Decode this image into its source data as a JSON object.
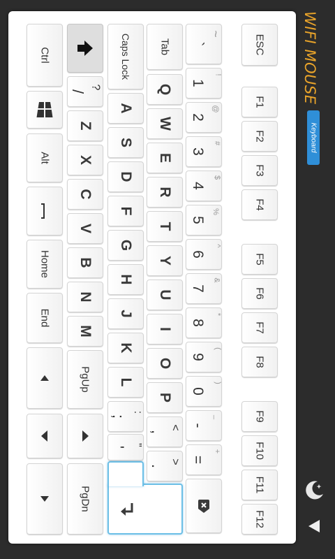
{
  "brand": {
    "title": "WIFI MOUSE",
    "subtitle": "Keyboard"
  },
  "keys": {
    "esc": "ESC",
    "f1": "F1",
    "f2": "F2",
    "f3": "F3",
    "f4": "F4",
    "f5": "F5",
    "f6": "F6",
    "f7": "F7",
    "f8": "F8",
    "f9": "F9",
    "f10": "F10",
    "f11": "F11",
    "f12": "F12",
    "grave": "`",
    "grave_shift": "~",
    "d1": "1",
    "d1s": "!",
    "d2": "2",
    "d2s": "@",
    "d3": "3",
    "d3s": "#",
    "d4": "4",
    "d4s": "$",
    "d5": "5",
    "d5s": "%",
    "d6": "6",
    "d6s": "^",
    "d7": "7",
    "d7s": "&",
    "d8": "8",
    "d8s": "*",
    "d9": "9",
    "d9s": "(",
    "d0": "0",
    "d0s": ")",
    "minus": "-",
    "minus_s": "_",
    "equal": "=",
    "equal_s": "+",
    "tab": "Tab",
    "q": "Q",
    "w": "W",
    "e": "E",
    "r": "R",
    "t": "T",
    "y": "Y",
    "u": "U",
    "i": "I",
    "o": "O",
    "p": "P",
    "comma_lt": ",",
    "comma_lt_s": "<",
    "period_gt": ".",
    "period_gt_s": ">",
    "caps": "Caps Lock",
    "a": "A",
    "s": "S",
    "d": "D",
    "f": "F",
    "g": "G",
    "h": "H",
    "j": "J",
    "k": "K",
    "l": "L",
    "semi": ";",
    "semi_s": ":",
    "quote": "'",
    "quote_s": "\"",
    "slash": "/",
    "slash_s": "?",
    "z": "Z",
    "x": "X",
    "c": "C",
    "v": "V",
    "b": "B",
    "n": "N",
    "m": "M",
    "pgup": "PgUp",
    "pgdn": "PgDn",
    "ctrl": "Ctrl",
    "alt": "Alt",
    "home": "Home",
    "end": "End"
  },
  "icons": {
    "shift": "shift-arrow-icon",
    "windows": "windows-logo-icon",
    "space": "space-bar-icon",
    "up": "arrow-up-icon",
    "down": "arrow-down-icon",
    "left": "arrow-left-icon",
    "right": "arrow-right-icon",
    "enter": "enter-return-icon",
    "backspace": "backspace-icon",
    "night": "night-mode-icon",
    "back": "back-triangle-icon"
  },
  "colors": {
    "brand_title": "#e8a32a",
    "brand_badge": "#2f8fd8",
    "enter_border": "#6cbfe6"
  }
}
